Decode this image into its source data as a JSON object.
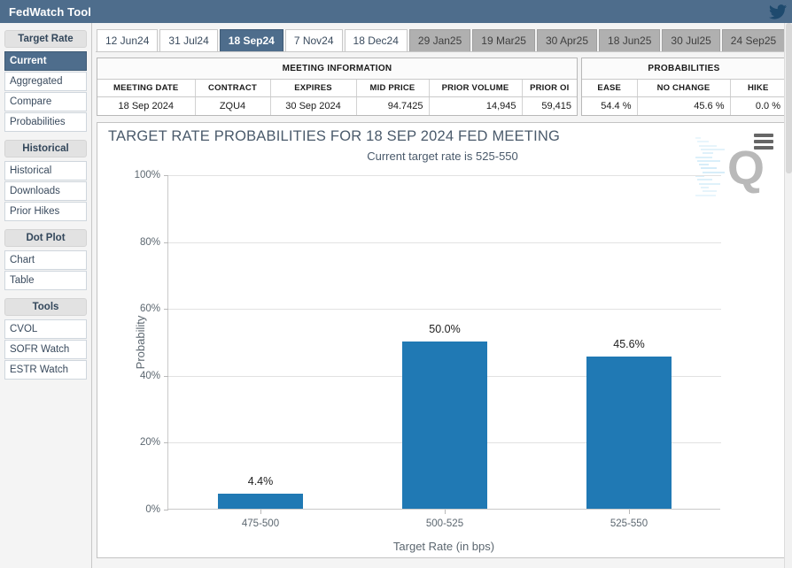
{
  "header": {
    "title": "FedWatch Tool",
    "twitter_icon": "twitter-bird-icon",
    "bar_color": "#4e6d8c"
  },
  "sidebar": {
    "groups": [
      {
        "heading": "Target Rate",
        "items": [
          {
            "label": "Current",
            "active": true
          },
          {
            "label": "Aggregated",
            "active": false
          },
          {
            "label": "Compare",
            "active": false
          },
          {
            "label": "Probabilities",
            "active": false
          }
        ]
      },
      {
        "heading": "Historical",
        "items": [
          {
            "label": "Historical",
            "active": false
          },
          {
            "label": "Downloads",
            "active": false
          },
          {
            "label": "Prior Hikes",
            "active": false
          }
        ]
      },
      {
        "heading": "Dot Plot",
        "items": [
          {
            "label": "Chart",
            "active": false
          },
          {
            "label": "Table",
            "active": false
          }
        ]
      },
      {
        "heading": "Tools",
        "items": [
          {
            "label": "CVOL",
            "active": false
          },
          {
            "label": "SOFR Watch",
            "active": false
          },
          {
            "label": "ESTR Watch",
            "active": false
          }
        ]
      }
    ]
  },
  "tabs": [
    {
      "label": "12 Jun24",
      "state": "normal"
    },
    {
      "label": "31 Jul24",
      "state": "normal"
    },
    {
      "label": "18 Sep24",
      "state": "selected"
    },
    {
      "label": "7 Nov24",
      "state": "normal"
    },
    {
      "label": "18 Dec24",
      "state": "normal"
    },
    {
      "label": "29 Jan25",
      "state": "disabled"
    },
    {
      "label": "19 Mar25",
      "state": "disabled"
    },
    {
      "label": "30 Apr25",
      "state": "disabled"
    },
    {
      "label": "18 Jun25",
      "state": "disabled"
    },
    {
      "label": "30 Jul25",
      "state": "disabled"
    },
    {
      "label": "24 Sep25",
      "state": "disabled"
    }
  ],
  "meeting_information": {
    "caption": "MEETING INFORMATION",
    "columns": [
      "MEETING DATE",
      "CONTRACT",
      "EXPIRES",
      "MID PRICE",
      "PRIOR VOLUME",
      "PRIOR OI"
    ],
    "row": [
      "18 Sep 2024",
      "ZQU4",
      "30 Sep 2024",
      "94.7425",
      "14,945",
      "59,415"
    ]
  },
  "probabilities": {
    "caption": "PROBABILITIES",
    "columns": [
      "EASE",
      "NO CHANGE",
      "HIKE"
    ],
    "row": [
      "54.4 %",
      "45.6 %",
      "0.0 %"
    ]
  },
  "chart_data": {
    "type": "bar",
    "title": "TARGET RATE PROBABILITIES FOR 18 SEP 2024 FED MEETING",
    "subtitle": "Current target rate is 525-550",
    "categories": [
      "475-500",
      "500-525",
      "525-550"
    ],
    "values": [
      4.4,
      50.0,
      45.6
    ],
    "value_labels": [
      "4.4%",
      "50.0%",
      "45.6%"
    ],
    "xlabel": "Target Rate (in bps)",
    "ylabel": "Probability",
    "ylim": [
      0,
      100
    ],
    "yticks": [
      0,
      20,
      40,
      60,
      80,
      100
    ],
    "ytick_labels": [
      "0%",
      "20%",
      "40%",
      "60%",
      "80%",
      "100%"
    ],
    "grid": true,
    "legend": "none",
    "bar_color": "#2079b4",
    "watermark": "Q",
    "menu_icon": "hamburger-menu-icon"
  }
}
